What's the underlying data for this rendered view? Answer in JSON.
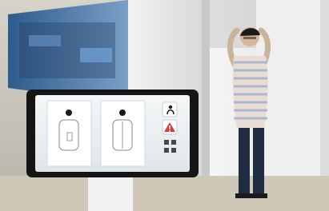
{
  "scene": {
    "description_hidden": "",
    "monitor": {
      "screen": {
        "panels": [
          {
            "id": "front-scan"
          },
          {
            "id": "back-scan"
          }
        ],
        "side_icons": [
          {
            "name": "person-silhouette-icon"
          },
          {
            "name": "alert-icon"
          },
          {
            "name": "small-control-icons"
          }
        ],
        "accent_colors": {
          "alert": "#e53935",
          "frame": "#1a1a1a",
          "screen_bg": "#e9edf0"
        }
      }
    }
  }
}
